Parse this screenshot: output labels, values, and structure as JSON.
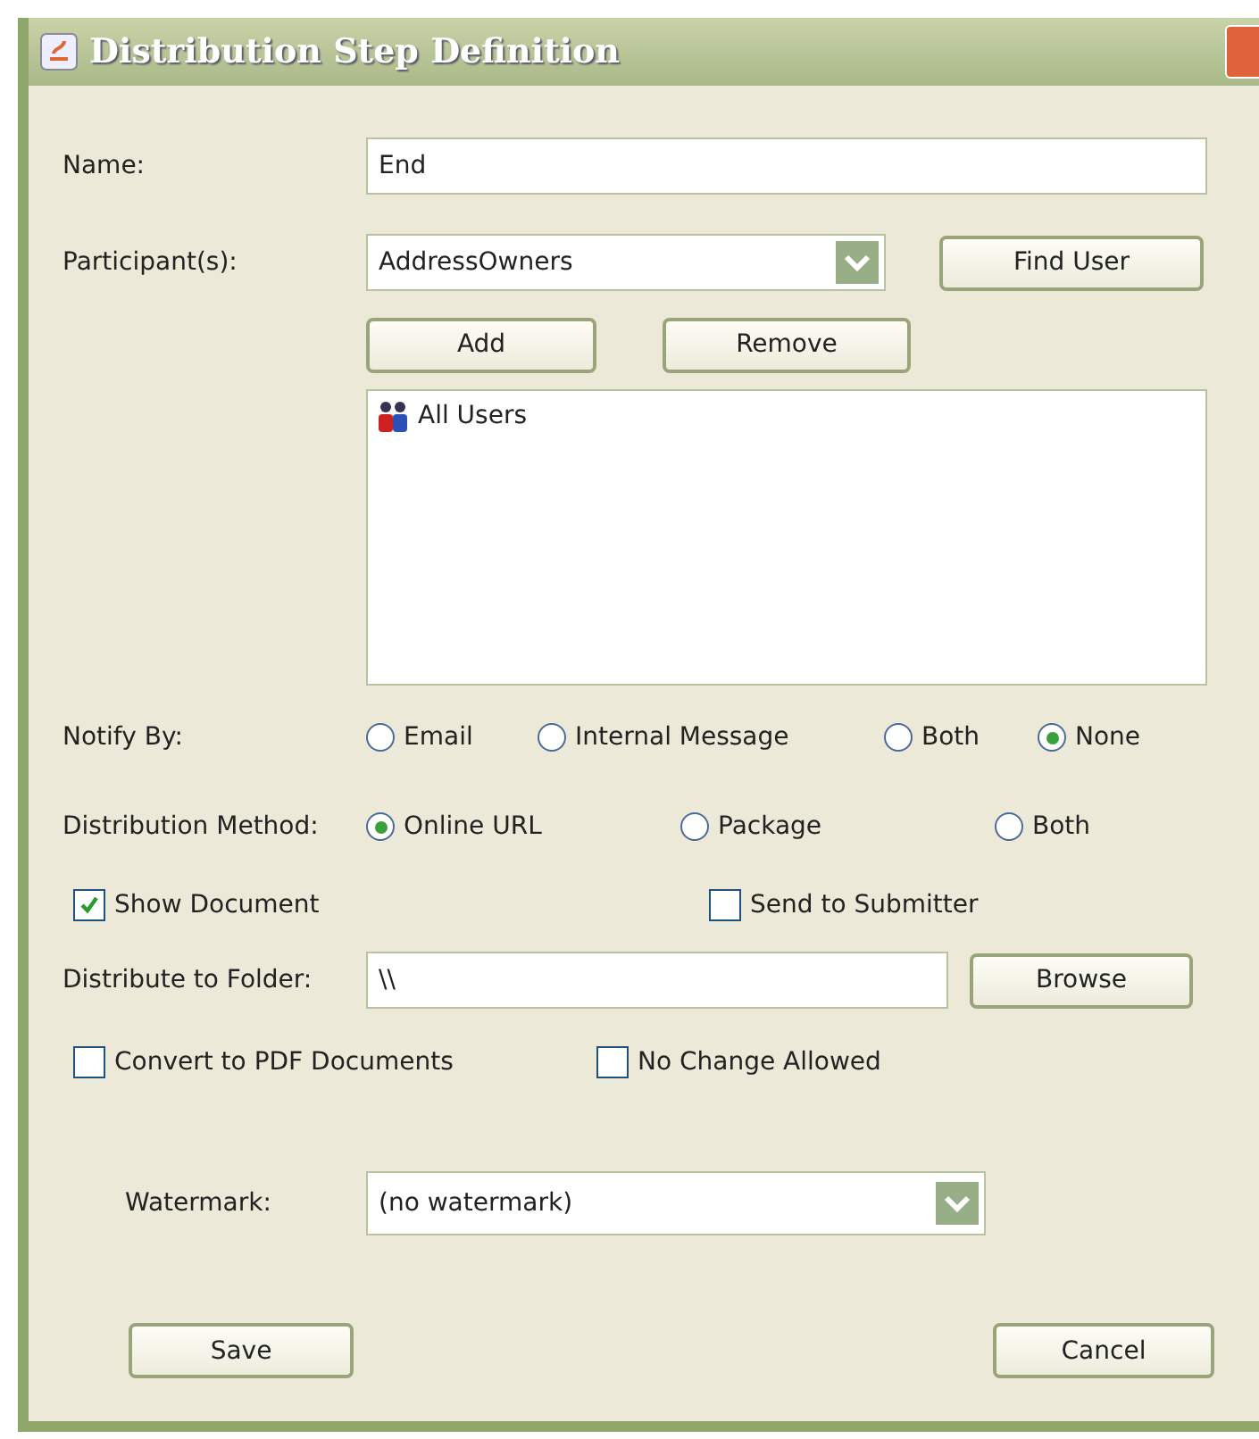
{
  "window": {
    "title": "Distribution Step Definition"
  },
  "name": {
    "label": "Name:",
    "value": "End"
  },
  "participants": {
    "label": "Participant(s):",
    "selected_value": "AddressOwners",
    "find_button": "Find User",
    "add_button": "Add",
    "remove_button": "Remove",
    "list": [
      {
        "label": "All Users",
        "selected": false
      }
    ]
  },
  "notify_by": {
    "label": "Notify By:",
    "options": [
      {
        "label": "Email",
        "selected": false
      },
      {
        "label": "Internal Message",
        "selected": false
      },
      {
        "label": "Both",
        "selected": false
      },
      {
        "label": "None",
        "selected": true
      }
    ]
  },
  "distribution_method": {
    "label": "Distribution Method:",
    "options": [
      {
        "label": "Online URL",
        "selected": true
      },
      {
        "label": "Package",
        "selected": false
      },
      {
        "label": "Both",
        "selected": false
      }
    ]
  },
  "show_document": {
    "label": "Show Document",
    "checked": true
  },
  "send_to_submitter": {
    "label": "Send to Submitter",
    "checked": false
  },
  "folder": {
    "label": "Distribute to Folder:",
    "value": "\\\\",
    "browse_button": "Browse"
  },
  "convert_pdf": {
    "label": "Convert to PDF Documents",
    "checked": false
  },
  "no_change": {
    "label": "No Change Allowed",
    "checked": false
  },
  "watermark": {
    "label": "Watermark:",
    "selected_value": "(no watermark)"
  },
  "buttons": {
    "save": "Save",
    "cancel": "Cancel"
  }
}
